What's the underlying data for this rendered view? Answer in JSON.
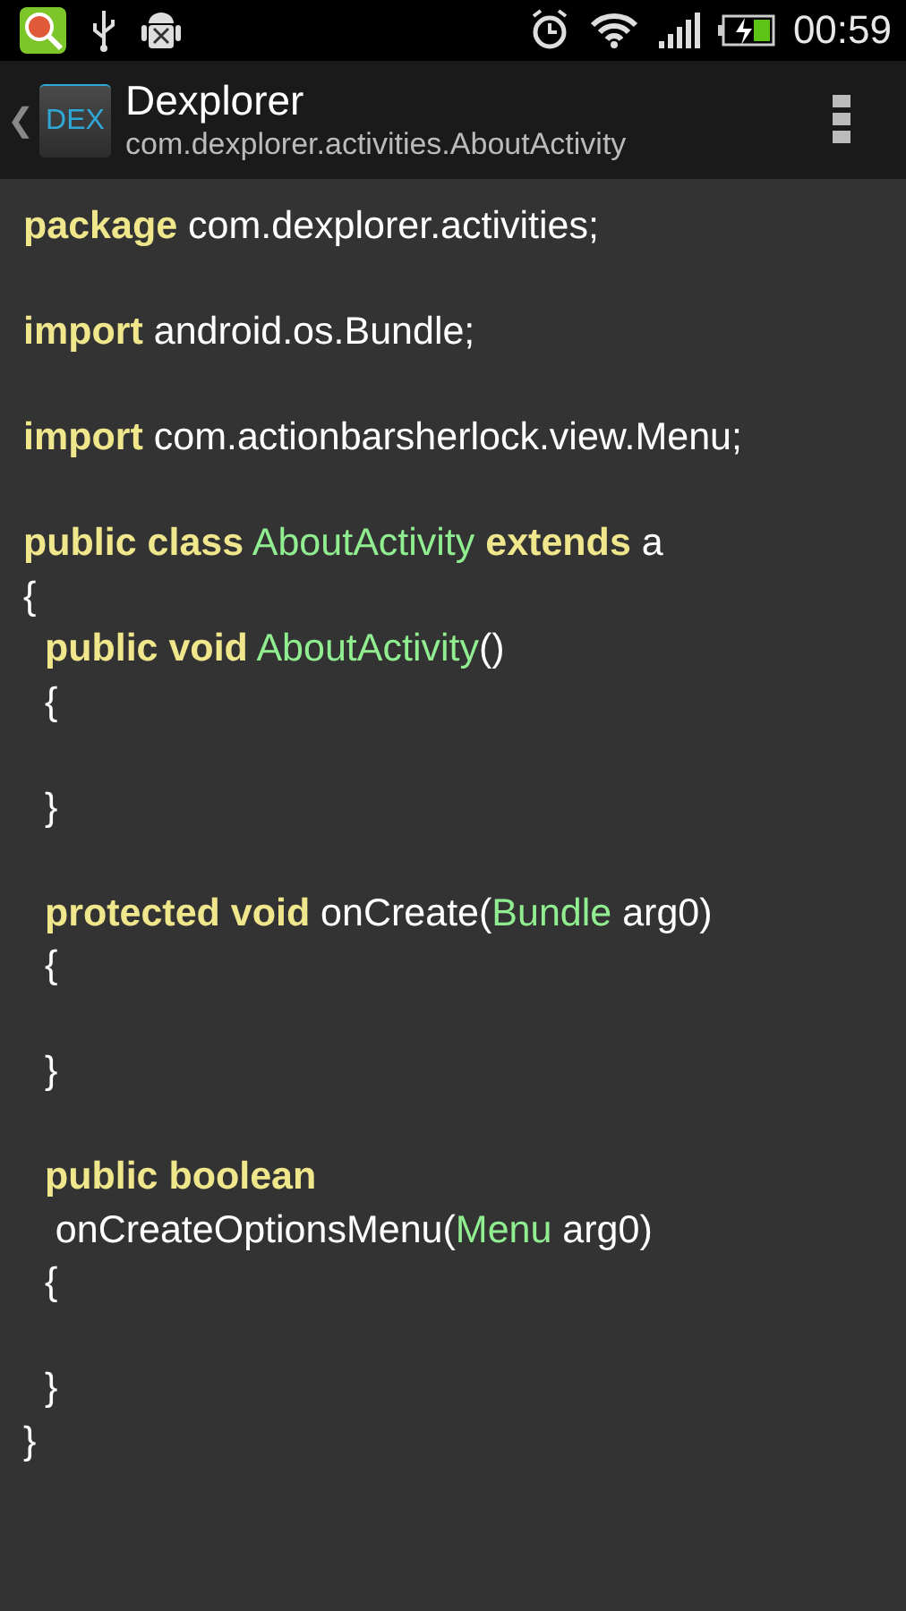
{
  "status_bar": {
    "time": "00:59"
  },
  "action_bar": {
    "back": "❮",
    "title": "Dexplorer",
    "subtitle": "com.dexplorer.activities.AboutActivity",
    "app_icon_text": "DEX"
  },
  "code": [
    {
      "kind": "code",
      "tokens": [
        {
          "kind": "keyword",
          "text": "package"
        },
        {
          "kind": "plain",
          "text": " com.dexplorer.activities;"
        }
      ]
    },
    {
      "kind": "blank"
    },
    {
      "kind": "code",
      "tokens": [
        {
          "kind": "keyword",
          "text": "import"
        },
        {
          "kind": "plain",
          "text": " android.os.Bundle;"
        }
      ]
    },
    {
      "kind": "blank"
    },
    {
      "kind": "code",
      "tokens": [
        {
          "kind": "keyword",
          "text": "import"
        },
        {
          "kind": "plain",
          "text": " com.actionbarsherlock.view.Menu;"
        }
      ]
    },
    {
      "kind": "blank"
    },
    {
      "kind": "code",
      "tokens": [
        {
          "kind": "keyword",
          "text": "public class"
        },
        {
          "kind": "type",
          "text": " AboutActivity"
        },
        {
          "kind": "keyword",
          "text": " extends"
        },
        {
          "kind": "plain",
          "text": " a"
        }
      ]
    },
    {
      "kind": "code",
      "tokens": [
        {
          "kind": "plain",
          "text": "{"
        }
      ]
    },
    {
      "kind": "code",
      "tokens": [
        {
          "kind": "keyword",
          "text": "  public void"
        },
        {
          "kind": "type",
          "text": " AboutActivity"
        },
        {
          "kind": "plain",
          "text": "()"
        }
      ]
    },
    {
      "kind": "code",
      "tokens": [
        {
          "kind": "plain",
          "text": "  {"
        }
      ]
    },
    {
      "kind": "blank"
    },
    {
      "kind": "code",
      "tokens": [
        {
          "kind": "plain",
          "text": "  }"
        }
      ]
    },
    {
      "kind": "blank"
    },
    {
      "kind": "code",
      "tokens": [
        {
          "kind": "keyword",
          "text": "  protected void"
        },
        {
          "kind": "plain",
          "text": " onCreate("
        },
        {
          "kind": "type",
          "text": "Bundle"
        },
        {
          "kind": "plain",
          "text": " arg0)"
        }
      ]
    },
    {
      "kind": "code",
      "tokens": [
        {
          "kind": "plain",
          "text": "  {"
        }
      ]
    },
    {
      "kind": "blank"
    },
    {
      "kind": "code",
      "tokens": [
        {
          "kind": "plain",
          "text": "  }"
        }
      ]
    },
    {
      "kind": "blank"
    },
    {
      "kind": "code",
      "tokens": [
        {
          "kind": "keyword",
          "text": "  public boolean"
        }
      ]
    },
    {
      "kind": "code",
      "tokens": [
        {
          "kind": "plain",
          "text": "   onCreateOptionsMenu("
        },
        {
          "kind": "type",
          "text": "Menu"
        },
        {
          "kind": "plain",
          "text": " arg0)"
        }
      ]
    },
    {
      "kind": "code",
      "tokens": [
        {
          "kind": "plain",
          "text": "  {"
        }
      ]
    },
    {
      "kind": "blank"
    },
    {
      "kind": "code",
      "tokens": [
        {
          "kind": "plain",
          "text": "  }"
        }
      ]
    },
    {
      "kind": "code",
      "tokens": [
        {
          "kind": "plain",
          "text": "}"
        }
      ]
    }
  ]
}
